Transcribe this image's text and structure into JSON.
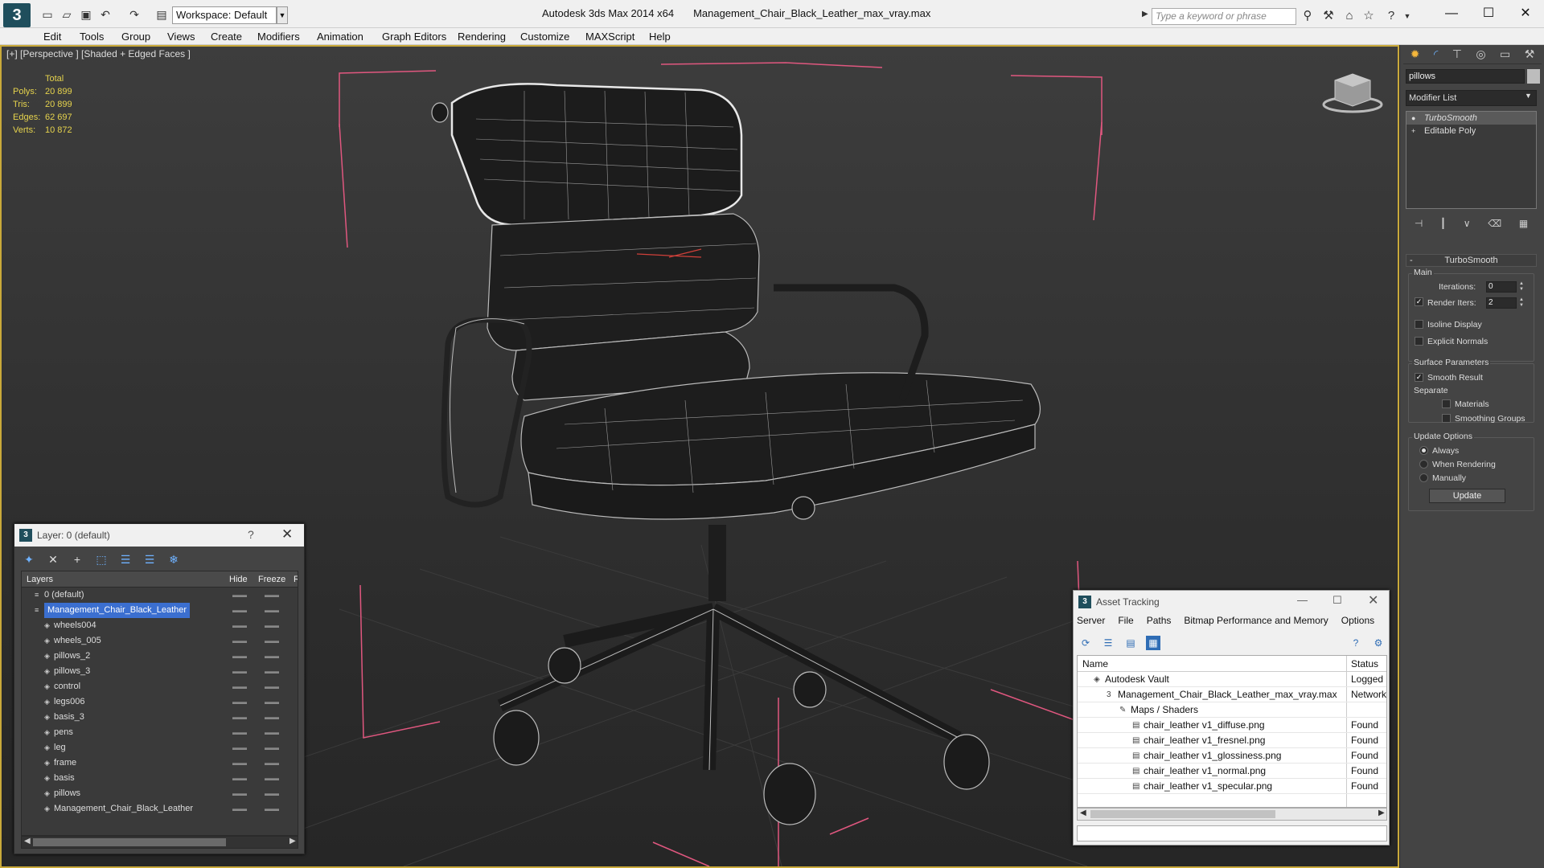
{
  "titlebar": {
    "workspace": "Workspace: Default",
    "app_title": "Autodesk 3ds Max  2014 x64",
    "file_title": "Management_Chair_Black_Leather_max_vray.max",
    "search_placeholder": "Type a keyword or phrase"
  },
  "menu": [
    "Edit",
    "Tools",
    "Group",
    "Views",
    "Create",
    "Modifiers",
    "Animation",
    "Graph Editors",
    "Rendering",
    "Customize",
    "MAXScript",
    "Help"
  ],
  "viewport": {
    "label": "[+] [Perspective ] [Shaded + Edged Faces ]",
    "stats": {
      "header": "Total",
      "rows": [
        {
          "k": "Polys:",
          "v": "20 899"
        },
        {
          "k": "Tris:",
          "v": "20 899"
        },
        {
          "k": "Edges:",
          "v": "62 697"
        },
        {
          "k": "Verts:",
          "v": "10 872"
        }
      ]
    }
  },
  "command_panel": {
    "object_name": "pillows",
    "modifier_list": "Modifier List",
    "stack": [
      "TurboSmooth",
      "Editable Poly"
    ],
    "rollout_title": "TurboSmooth",
    "main_group": "Main",
    "iterations_label": "Iterations:",
    "iterations_value": "0",
    "render_iters_label": "Render Iters:",
    "render_iters_value": "2",
    "isoline_label": "Isoline Display",
    "explicit_label": "Explicit Normals",
    "surface_group": "Surface Parameters",
    "smooth_result": "Smooth Result",
    "separate": "Separate",
    "materials": "Materials",
    "smoothing_groups": "Smoothing Groups",
    "update_group": "Update Options",
    "always": "Always",
    "when_rendering": "When Rendering",
    "manually": "Manually",
    "update_button": "Update"
  },
  "layer_dialog": {
    "title": "Layer: 0 (default)",
    "help": "?",
    "columns": {
      "layers": "Layers",
      "hide": "Hide",
      "freeze": "Freeze",
      "r": "R"
    },
    "rows": [
      {
        "name": "0 (default)",
        "level": 0,
        "type": "layer"
      },
      {
        "name": "Management_Chair_Black_Leather",
        "level": 0,
        "type": "layer",
        "selected": true
      },
      {
        "name": "wheels004",
        "level": 1,
        "type": "object"
      },
      {
        "name": "wheels_005",
        "level": 1,
        "type": "object"
      },
      {
        "name": "pillows_2",
        "level": 1,
        "type": "object"
      },
      {
        "name": "pillows_3",
        "level": 1,
        "type": "object"
      },
      {
        "name": "control",
        "level": 1,
        "type": "object"
      },
      {
        "name": "legs006",
        "level": 1,
        "type": "object"
      },
      {
        "name": "basis_3",
        "level": 1,
        "type": "object"
      },
      {
        "name": "pens",
        "level": 1,
        "type": "object"
      },
      {
        "name": "leg",
        "level": 1,
        "type": "object"
      },
      {
        "name": "frame",
        "level": 1,
        "type": "object"
      },
      {
        "name": "basis",
        "level": 1,
        "type": "object"
      },
      {
        "name": "pillows",
        "level": 1,
        "type": "object"
      },
      {
        "name": "Management_Chair_Black_Leather",
        "level": 1,
        "type": "object"
      }
    ]
  },
  "asset_dialog": {
    "title": "Asset Tracking",
    "menu": [
      "Server",
      "File",
      "Paths",
      "Bitmap Performance and Memory",
      "Options"
    ],
    "columns": {
      "name": "Name",
      "status": "Status"
    },
    "rows": [
      {
        "name": "Autodesk Vault",
        "level": 0,
        "status": "Logged Out"
      },
      {
        "name": "Management_Chair_Black_Leather_max_vray.max",
        "level": 1,
        "status": "Network"
      },
      {
        "name": "Maps / Shaders",
        "level": 2,
        "status": ""
      },
      {
        "name": "chair_leather v1_diffuse.png",
        "level": 3,
        "status": "Found"
      },
      {
        "name": "chair_leather v1_fresnel.png",
        "level": 3,
        "status": "Found"
      },
      {
        "name": "chair_leather v1_glossiness.png",
        "level": 3,
        "status": "Found"
      },
      {
        "name": "chair_leather v1_normal.png",
        "level": 3,
        "status": "Found"
      },
      {
        "name": "chair_leather v1_specular.png",
        "level": 3,
        "status": "Found"
      }
    ]
  },
  "colors": {
    "viewport_border": "#c9a93a",
    "stats_text": "#e6d34d",
    "selection": "#3b6fd0",
    "bounding_box": "#e0577f",
    "wireframe": "#bbbbbb"
  }
}
